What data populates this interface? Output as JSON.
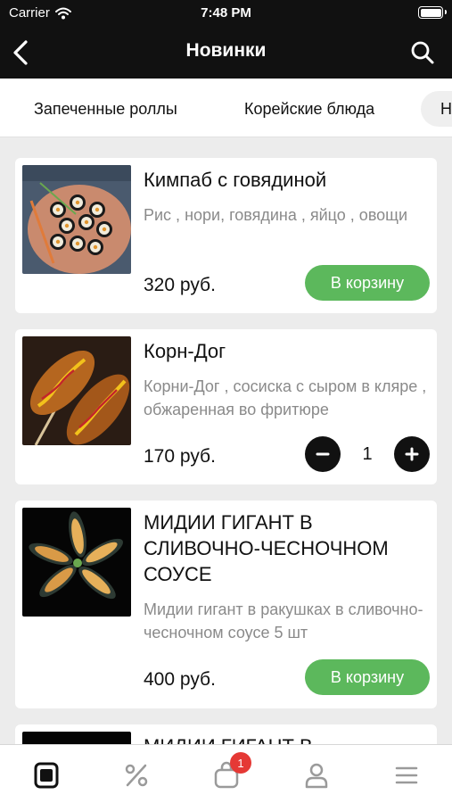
{
  "status_bar": {
    "carrier": "Carrier",
    "time": "7:48 PM"
  },
  "nav": {
    "title": "Новинки",
    "back_icon": "chevron-left-icon",
    "search_icon": "search-icon"
  },
  "categories": [
    {
      "label": "Запеченные роллы"
    },
    {
      "label": "Корейские блюда"
    },
    {
      "label": "Н"
    }
  ],
  "products": [
    {
      "name": "Кимпаб с говядиной",
      "description": "Рис , нори, говядина , яйцо , овощи",
      "price": "320 руб.",
      "action": "В корзину"
    },
    {
      "name": "Корн-Дог",
      "description": "Корни-Дог , сосиска с сыром в кляре , обжаренная во фритюре",
      "price": "170 руб.",
      "quantity": "1"
    },
    {
      "name": "МИДИИ ГИГАНТ В СЛИВОЧНО-ЧЕСНОЧНОМ СОУСЕ",
      "description": "Мидии гигант в ракушках в сливочно-чесночном соусе 5 шт",
      "price": "400 руб.",
      "action": "В корзину"
    },
    {
      "name": "МИДИИ ГИГАНТ В"
    }
  ],
  "tab_bar": {
    "items": [
      {
        "icon": "menu-book-icon",
        "active": true
      },
      {
        "icon": "percent-icon",
        "active": false
      },
      {
        "icon": "cart-bag-icon",
        "active": false,
        "badge": "1"
      },
      {
        "icon": "profile-icon",
        "active": false
      },
      {
        "icon": "hamburger-menu-icon",
        "active": false
      }
    ]
  },
  "colors": {
    "header": "#111111",
    "accent_green": "#5cb85c",
    "badge_red": "#e53935",
    "inactive_icon": "#9a9a9a"
  }
}
